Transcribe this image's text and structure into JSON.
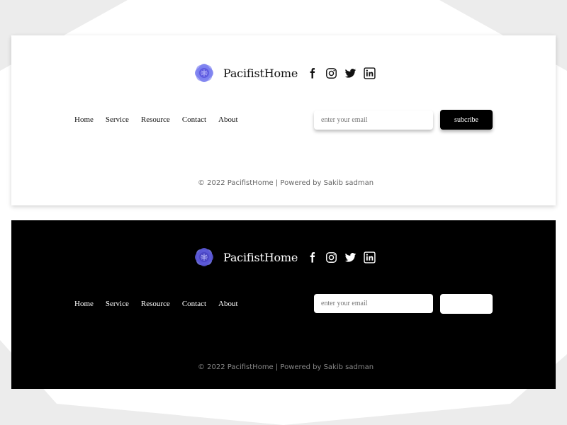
{
  "brand": {
    "name": "PacifistHome"
  },
  "social": [
    "facebook-icon",
    "instagram-icon",
    "twitter-icon",
    "linkedin-icon"
  ],
  "nav": {
    "items": [
      "Home",
      "Service",
      "Resource",
      "Contact",
      "About"
    ]
  },
  "newsletter": {
    "placeholder": "enter your email",
    "button_label": "subcribe"
  },
  "copyright": "© 2022 PacifistHome | Powered by Sakib sadman",
  "colors": {
    "logo_primary": "#7b7ff0",
    "logo_dark": "#4a45c4",
    "dark_bg": "#000000",
    "light_bg": "#ffffff"
  }
}
